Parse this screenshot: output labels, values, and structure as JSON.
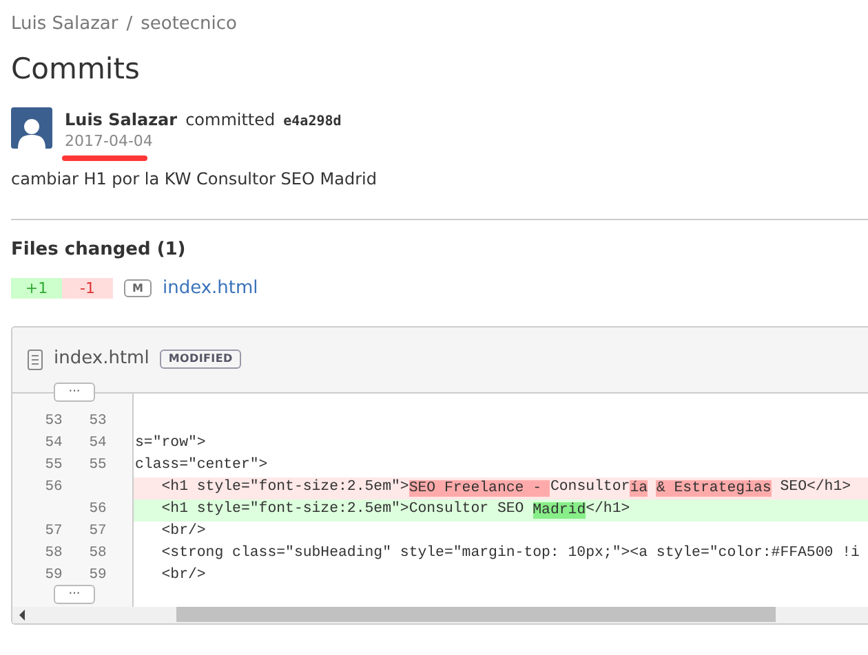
{
  "breadcrumb": {
    "owner": "Luis Salazar",
    "separator": "/",
    "repo": "seotecnico"
  },
  "title": "Commits",
  "commit": {
    "author": "Luis Salazar",
    "action": "committed",
    "hash": "e4a298d",
    "date": "2017-04-04",
    "message": "cambiar H1 por la KW Consultor SEO Madrid"
  },
  "files_changed": {
    "heading": "Files changed (1)",
    "additions": "+1",
    "deletions": "-1",
    "files": [
      {
        "status": "M",
        "name": "index.html"
      }
    ]
  },
  "diff": {
    "file": "index.html",
    "status": "MODIFIED",
    "expand_label": "···",
    "lines": [
      {
        "kind": "context",
        "old": "53",
        "new": "53"
      },
      {
        "kind": "context",
        "old": "54",
        "new": "54",
        "segments": [
          {
            "text": "s=\"row\">",
            "changed": false
          }
        ]
      },
      {
        "kind": "context",
        "old": "55",
        "new": "55",
        "segments": [
          {
            "text": "class=\"center\">",
            "changed": false
          }
        ]
      },
      {
        "kind": "deleted",
        "old": "56",
        "segments": [
          {
            "text": "   <h1 style=\"font-size:2.5em\">",
            "changed": false
          },
          {
            "text": "SEO Freelance - ",
            "changed": true
          },
          {
            "text": "Consultor",
            "changed": false
          },
          {
            "text": "ía",
            "changed": true
          },
          {
            "text": " & Estrategias",
            "changed": true
          },
          {
            "text": " SEO</h1>",
            "changed": false
          }
        ]
      },
      {
        "kind": "added",
        "new": "56",
        "segments": [
          {
            "text": "   <h1 style=\"font-size:2.5em\">Consultor SEO ",
            "changed": false
          },
          {
            "text": "Madrid",
            "changed": true
          },
          {
            "text": "</h1>",
            "changed": false
          }
        ]
      },
      {
        "kind": "context",
        "old": "57",
        "new": "57",
        "segments": [
          {
            "text": "   <br/>",
            "changed": false
          }
        ]
      },
      {
        "kind": "context",
        "old": "58",
        "new": "58",
        "segments": [
          {
            "text": "   <strong class=\"subHeading\" style=\"margin-top: 10px;\"><a style=\"color:#FFA500 !i",
            "changed": false
          }
        ]
      },
      {
        "kind": "context",
        "old": "59",
        "new": "59",
        "segments": [
          {
            "text": "   <br/>",
            "changed": false
          }
        ]
      }
    ]
  }
}
